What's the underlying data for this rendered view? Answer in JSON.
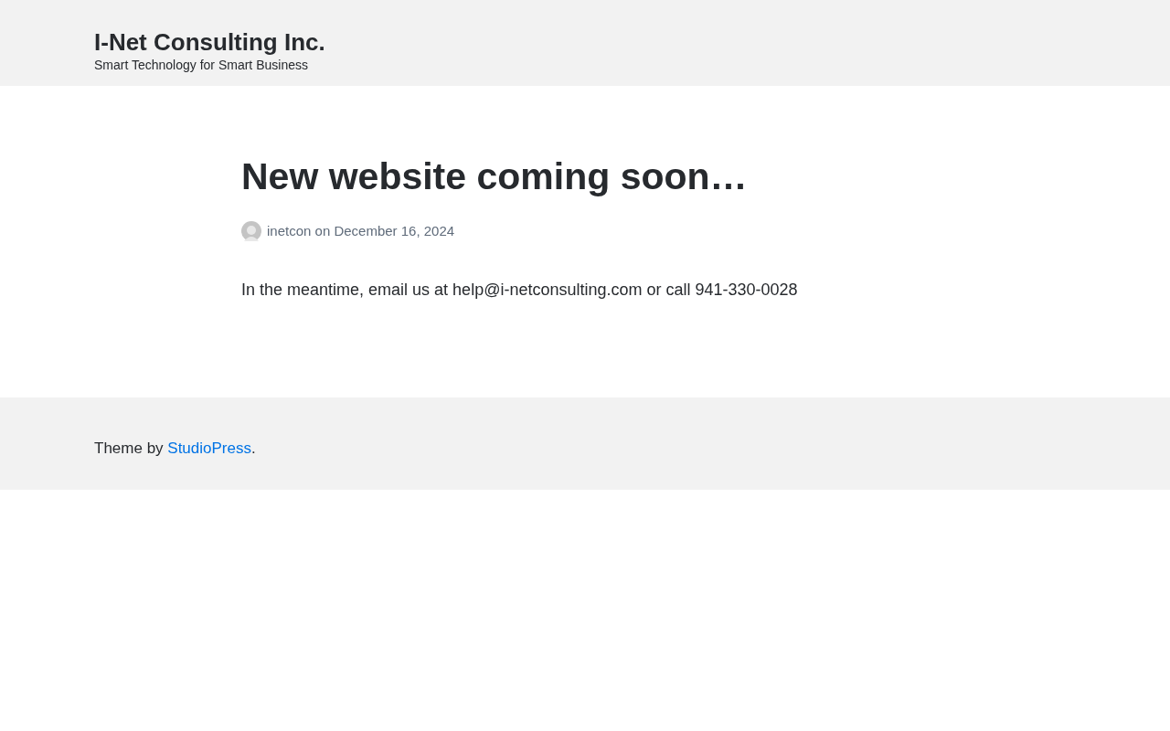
{
  "header": {
    "site_title": "I-Net Consulting Inc.",
    "tagline": "Smart Technology for Smart Business"
  },
  "post": {
    "title": "New website coming soon…",
    "byline": "inetcon on December 16, 2024",
    "body": "In the meantime, email us at help@i-netconsulting.com or call 941-330-0028"
  },
  "footer": {
    "prefix": "Theme by ",
    "link": "StudioPress",
    "suffix": "."
  }
}
